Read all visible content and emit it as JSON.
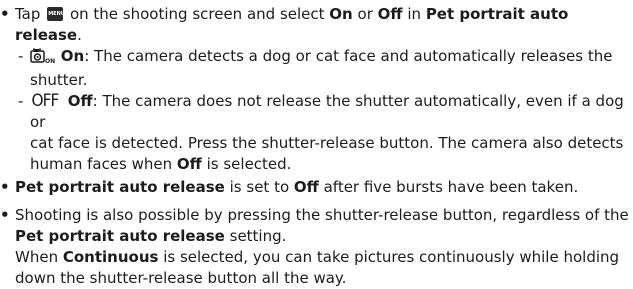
{
  "b1": {
    "pre": "Tap",
    "menu_icon_text": "MENU",
    "mid": "on the shooting screen and select",
    "on": "On",
    "or": "or",
    "off": "Off",
    "in": "in",
    "setting": "Pet portrait auto release",
    "end": "."
  },
  "sub1": {
    "dash": "-",
    "label": "On",
    "text": ": The camera detects a dog or cat face and automatically releases the",
    "text2": "shutter."
  },
  "sub2": {
    "dash": "-",
    "icon_text": "OFF",
    "label": "Off",
    "text": ": The camera does not release the shutter automatically, even if a dog or",
    "text2": "cat face is detected. Press the shutter-release button. The camera also detects",
    "text3_pre": "human faces when",
    "text3_bold": "Off",
    "text3_post": "is selected."
  },
  "b2": {
    "bold1": "Pet portrait auto release",
    "mid": "is set to",
    "bold2": "Off",
    "end": "after five bursts have been taken."
  },
  "b3": {
    "line1": "Shooting is also possible by pressing the shutter-release button, regardless of the",
    "bold1": "Pet portrait auto release",
    "line2_end": "setting.",
    "line3_pre": "When",
    "bold2": "Continuous",
    "line3_post": "is selected, you can take pictures continuously while holding",
    "line4": "down the shutter-release button all the way."
  },
  "bullet_char": "•",
  "icons": {
    "menu": "menu-icon",
    "pet": "pet-portrait-on-icon",
    "off": "off-icon"
  }
}
